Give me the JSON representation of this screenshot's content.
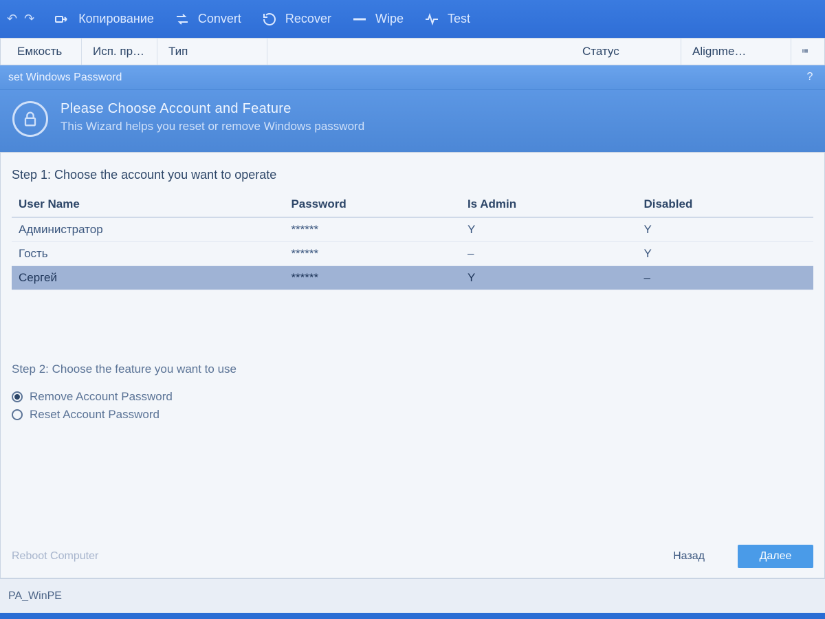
{
  "toolbar": {
    "undo": "↶",
    "redo": "↷",
    "items": [
      {
        "id": "copy",
        "label": "Копирование"
      },
      {
        "id": "convert",
        "label": "Convert"
      },
      {
        "id": "recover",
        "label": "Recover"
      },
      {
        "id": "wipe",
        "label": "Wipe"
      },
      {
        "id": "test",
        "label": "Test"
      }
    ]
  },
  "columns": {
    "c0": "Емкость",
    "c1": "Исп. пр…",
    "c2": "Тип",
    "c3": "Статус",
    "c4": "Alignme…"
  },
  "dialog": {
    "title": "set Windows Password",
    "help": "?"
  },
  "wizard": {
    "heading": "Please Choose Account and Feature",
    "sub": "This Wizard helps you reset or remove Windows password"
  },
  "step1": {
    "title": "Step 1: Choose the account you want to operate",
    "headers": {
      "user": "User Name",
      "pwd": "Password",
      "admin": "Is Admin",
      "disabled": "Disabled"
    },
    "rows": [
      {
        "user": "Администратор",
        "pwd": "******",
        "admin": "Y",
        "disabled": "Y",
        "selected": false
      },
      {
        "user": "Гость",
        "pwd": "******",
        "admin": "–",
        "disabled": "Y",
        "selected": false
      },
      {
        "user": "Сергей",
        "pwd": "******",
        "admin": "Y",
        "disabled": "–",
        "selected": true
      }
    ]
  },
  "step2": {
    "title": "Step 2: Choose the feature you want to use",
    "options": [
      {
        "label": "Remove Account Password",
        "checked": true
      },
      {
        "label": "Reset Account Password",
        "checked": false
      }
    ]
  },
  "footer": {
    "reboot": "Reboot Computer",
    "back": "Назад",
    "next": "Далее"
  },
  "status": {
    "line": "PA_WinPE"
  }
}
